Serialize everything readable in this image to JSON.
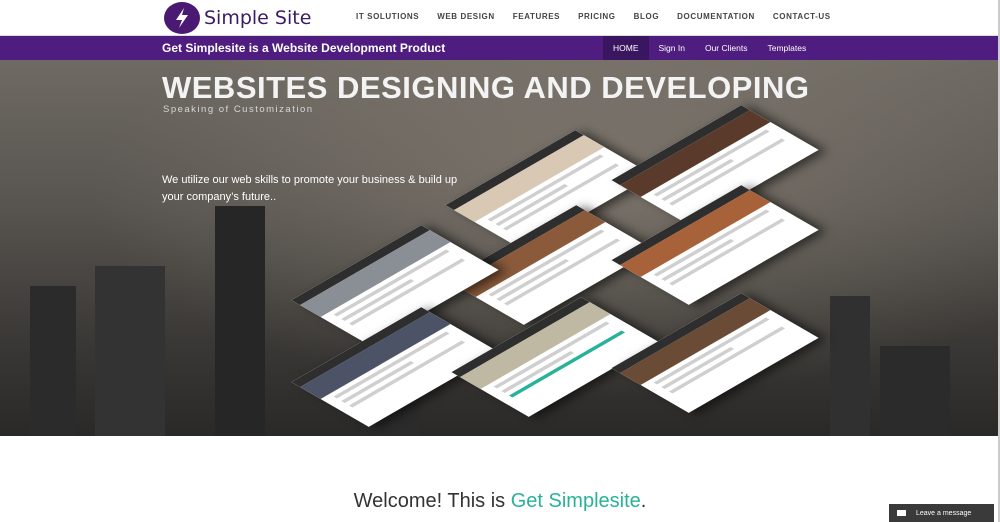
{
  "brand": {
    "name": "Simple Site",
    "color": "#4a1a73",
    "logo_icon": "lightning-bolt-icon"
  },
  "mainnav": [
    "IT SOLUTIONS",
    "WEB DESIGN",
    "FEATURES",
    "PRICING",
    "BLOG",
    "DOCUMENTATION",
    "CONTACT-US"
  ],
  "purplebar": {
    "tagline": "Get Simplesite is a Website Development Product",
    "links": [
      "HOME",
      "Sign In",
      "Our Clients",
      "Templates"
    ],
    "active": "HOME",
    "color": "#4e1d7f"
  },
  "hero": {
    "title": "WEBSITES DESIGNING AND DEVELOPING",
    "subtitle": "Speaking of Customization",
    "description": "We utilize our web skills to promote your business & build up your company’s future.."
  },
  "welcome": {
    "prefix": "Welcome! This is ",
    "brand": "Get Simplesite",
    "suffix": ".",
    "brand_color": "#2ab19a"
  },
  "chat": {
    "label": "Leave a message",
    "icon": "mail-icon"
  }
}
